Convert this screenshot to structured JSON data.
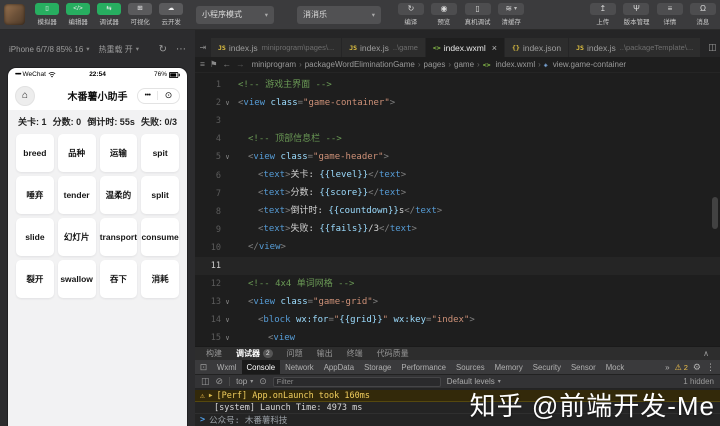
{
  "icons": {
    "simulator": "▯",
    "editor": "</>",
    "debugger": "⇆",
    "visual": "⊞",
    "cloud": "☁",
    "compile": "↻",
    "preview": "◉",
    "device": "▯",
    "cache": "≋",
    "upload": "↥",
    "branch": "Ψ",
    "details": "≡",
    "bell": "Ω"
  },
  "topbar": {
    "mode_buttons": [
      {
        "id": "simulator",
        "label": "模拟器",
        "active": true
      },
      {
        "id": "editor",
        "label": "编辑器",
        "active": true
      },
      {
        "id": "debugger",
        "label": "调试器",
        "active": true
      },
      {
        "id": "visual",
        "label": "可视化",
        "active": false
      },
      {
        "id": "cloud",
        "label": "云开发",
        "active": false
      }
    ],
    "mode_select": "小程序模式",
    "scene_select": "消消乐",
    "action_buttons": [
      {
        "id": "compile",
        "label": "编译"
      },
      {
        "id": "preview",
        "label": "预览"
      },
      {
        "id": "device",
        "label": "真机调试"
      },
      {
        "id": "cache",
        "label": "清缓存",
        "dropdown": true
      }
    ],
    "right_buttons": [
      {
        "id": "upload",
        "label": "上传"
      },
      {
        "id": "branch",
        "label": "版本管理"
      },
      {
        "id": "details",
        "label": "详情"
      },
      {
        "id": "bell",
        "label": "消息"
      }
    ]
  },
  "simulator": {
    "device_select": "iPhone 6/7/8 85% 16",
    "hot_reload": "热重载 开",
    "phone": {
      "carrier": "WeChat",
      "time": "22:54",
      "battery": "76%",
      "nav_title": "木番薯小助手",
      "stats": [
        {
          "label": "关卡",
          "value": "1"
        },
        {
          "label": "分数",
          "value": "0"
        },
        {
          "label": "倒计时",
          "value": "55s"
        },
        {
          "label": "失败",
          "value": "0/3"
        }
      ],
      "words": [
        "breed",
        "品种",
        "运输",
        "spit",
        "唾弃",
        "tender",
        "温柔的",
        "split",
        "slide",
        "幻灯片",
        "transport",
        "consume",
        "裂开",
        "swallow",
        "吞下",
        "消耗"
      ]
    }
  },
  "editor": {
    "tabs": [
      {
        "name": "index.js",
        "path": "miniprogram\\pages\\...",
        "icon": "js",
        "active": false
      },
      {
        "name": "index.js",
        "path": "..\\game",
        "icon": "js",
        "active": false
      },
      {
        "name": "index.wxml",
        "path": "",
        "icon": "wxml",
        "active": true
      },
      {
        "name": "index.json",
        "path": "",
        "icon": "json",
        "active": false
      },
      {
        "name": "index.js",
        "path": "..\\packageTemplate\\...",
        "icon": "js",
        "active": false
      }
    ],
    "breadcrumb": [
      {
        "label": "miniprogram"
      },
      {
        "label": "packageWordEliminationGame"
      },
      {
        "label": "pages"
      },
      {
        "label": "game"
      },
      {
        "label": "index.wxml",
        "icon": "wxml"
      },
      {
        "label": "view.game-container",
        "icon": "symbol"
      }
    ],
    "code": [
      {
        "n": 1,
        "indent": 0,
        "segs": [
          {
            "c": "cm",
            "t": "<!-- 游戏主界面 -->"
          }
        ]
      },
      {
        "n": 2,
        "indent": 0,
        "fold": true,
        "segs": [
          {
            "c": "pu",
            "t": "<"
          },
          {
            "c": "tg",
            "t": "view"
          },
          {
            "c": "tx",
            "t": " "
          },
          {
            "c": "at",
            "t": "class"
          },
          {
            "c": "pu",
            "t": "="
          },
          {
            "c": "st",
            "t": "\"game-container\""
          },
          {
            "c": "pu",
            "t": ">"
          }
        ]
      },
      {
        "n": 3,
        "indent": 0,
        "segs": []
      },
      {
        "n": 4,
        "indent": 1,
        "segs": [
          {
            "c": "cm",
            "t": "<!-- 顶部信息栏 -->"
          }
        ]
      },
      {
        "n": 5,
        "indent": 1,
        "fold": true,
        "segs": [
          {
            "c": "pu",
            "t": "<"
          },
          {
            "c": "tg",
            "t": "view"
          },
          {
            "c": "tx",
            "t": " "
          },
          {
            "c": "at",
            "t": "class"
          },
          {
            "c": "pu",
            "t": "="
          },
          {
            "c": "st",
            "t": "\"game-header\""
          },
          {
            "c": "pu",
            "t": ">"
          }
        ]
      },
      {
        "n": 6,
        "indent": 2,
        "segs": [
          {
            "c": "pu",
            "t": "<"
          },
          {
            "c": "tg",
            "t": "text"
          },
          {
            "c": "pu",
            "t": ">"
          },
          {
            "c": "tx",
            "t": "关卡: "
          },
          {
            "c": "ip",
            "t": "{{level}}"
          },
          {
            "c": "pu",
            "t": "</"
          },
          {
            "c": "tg",
            "t": "text"
          },
          {
            "c": "pu",
            "t": ">"
          }
        ]
      },
      {
        "n": 7,
        "indent": 2,
        "segs": [
          {
            "c": "pu",
            "t": "<"
          },
          {
            "c": "tg",
            "t": "text"
          },
          {
            "c": "pu",
            "t": ">"
          },
          {
            "c": "tx",
            "t": "分数: "
          },
          {
            "c": "ip",
            "t": "{{score}}"
          },
          {
            "c": "pu",
            "t": "</"
          },
          {
            "c": "tg",
            "t": "text"
          },
          {
            "c": "pu",
            "t": ">"
          }
        ]
      },
      {
        "n": 8,
        "indent": 2,
        "segs": [
          {
            "c": "pu",
            "t": "<"
          },
          {
            "c": "tg",
            "t": "text"
          },
          {
            "c": "pu",
            "t": ">"
          },
          {
            "c": "tx",
            "t": "倒计时: "
          },
          {
            "c": "ip",
            "t": "{{countdown}}"
          },
          {
            "c": "tx",
            "t": "s"
          },
          {
            "c": "pu",
            "t": "</"
          },
          {
            "c": "tg",
            "t": "text"
          },
          {
            "c": "pu",
            "t": ">"
          }
        ]
      },
      {
        "n": 9,
        "indent": 2,
        "segs": [
          {
            "c": "pu",
            "t": "<"
          },
          {
            "c": "tg",
            "t": "text"
          },
          {
            "c": "pu",
            "t": ">"
          },
          {
            "c": "tx",
            "t": "失败: "
          },
          {
            "c": "ip",
            "t": "{{fails}}"
          },
          {
            "c": "tx",
            "t": "/3"
          },
          {
            "c": "pu",
            "t": "</"
          },
          {
            "c": "tg",
            "t": "text"
          },
          {
            "c": "pu",
            "t": ">"
          }
        ]
      },
      {
        "n": 10,
        "indent": 1,
        "segs": [
          {
            "c": "pu",
            "t": "</"
          },
          {
            "c": "tg",
            "t": "view"
          },
          {
            "c": "pu",
            "t": ">"
          }
        ]
      },
      {
        "n": 11,
        "indent": 0,
        "current": true,
        "segs": []
      },
      {
        "n": 12,
        "indent": 1,
        "segs": [
          {
            "c": "cm",
            "t": "<!-- 4x4 单词网格 -->"
          }
        ]
      },
      {
        "n": 13,
        "indent": 1,
        "fold": true,
        "segs": [
          {
            "c": "pu",
            "t": "<"
          },
          {
            "c": "tg",
            "t": "view"
          },
          {
            "c": "tx",
            "t": " "
          },
          {
            "c": "at",
            "t": "class"
          },
          {
            "c": "pu",
            "t": "="
          },
          {
            "c": "st",
            "t": "\"game-grid\""
          },
          {
            "c": "pu",
            "t": ">"
          }
        ]
      },
      {
        "n": 14,
        "indent": 2,
        "fold": true,
        "segs": [
          {
            "c": "pu",
            "t": "<"
          },
          {
            "c": "tg",
            "t": "block"
          },
          {
            "c": "tx",
            "t": " "
          },
          {
            "c": "at",
            "t": "wx:for"
          },
          {
            "c": "pu",
            "t": "="
          },
          {
            "c": "st",
            "t": "\""
          },
          {
            "c": "ip",
            "t": "{{grid}}"
          },
          {
            "c": "st",
            "t": "\""
          },
          {
            "c": "tx",
            "t": " "
          },
          {
            "c": "at",
            "t": "wx:key"
          },
          {
            "c": "pu",
            "t": "="
          },
          {
            "c": "st",
            "t": "\"index\""
          },
          {
            "c": "pu",
            "t": ">"
          }
        ]
      },
      {
        "n": 15,
        "indent": 3,
        "fold": true,
        "segs": [
          {
            "c": "pu",
            "t": "<"
          },
          {
            "c": "tg",
            "t": "view"
          }
        ]
      }
    ]
  },
  "panel": {
    "tabs": [
      {
        "label": "构建"
      },
      {
        "label": "调试器",
        "badge": "2",
        "active": true
      },
      {
        "label": "问题"
      },
      {
        "label": "输出"
      },
      {
        "label": "终端"
      },
      {
        "label": "代码质量"
      }
    ],
    "devtools_tabs": [
      "Wxml",
      "Console",
      "Network",
      "AppData",
      "Storage",
      "Performance",
      "Sources",
      "Memory",
      "Security",
      "Sensor",
      "Mock"
    ],
    "devtools_active": "Console",
    "warning_count": "2",
    "console": {
      "context": "top",
      "filter_placeholder": "Filter",
      "levels": "Default levels",
      "hidden": "1 hidden",
      "logs": [
        {
          "type": "warn",
          "text": "[Perf] App.onLaunch took 160ms"
        },
        {
          "type": "info",
          "text": "[system] Launch Time: 4973 ms"
        },
        {
          "type": "prompt",
          "text": "公众号: 木番薯科技"
        }
      ]
    }
  },
  "watermark": "知乎 @前端开发-Me"
}
